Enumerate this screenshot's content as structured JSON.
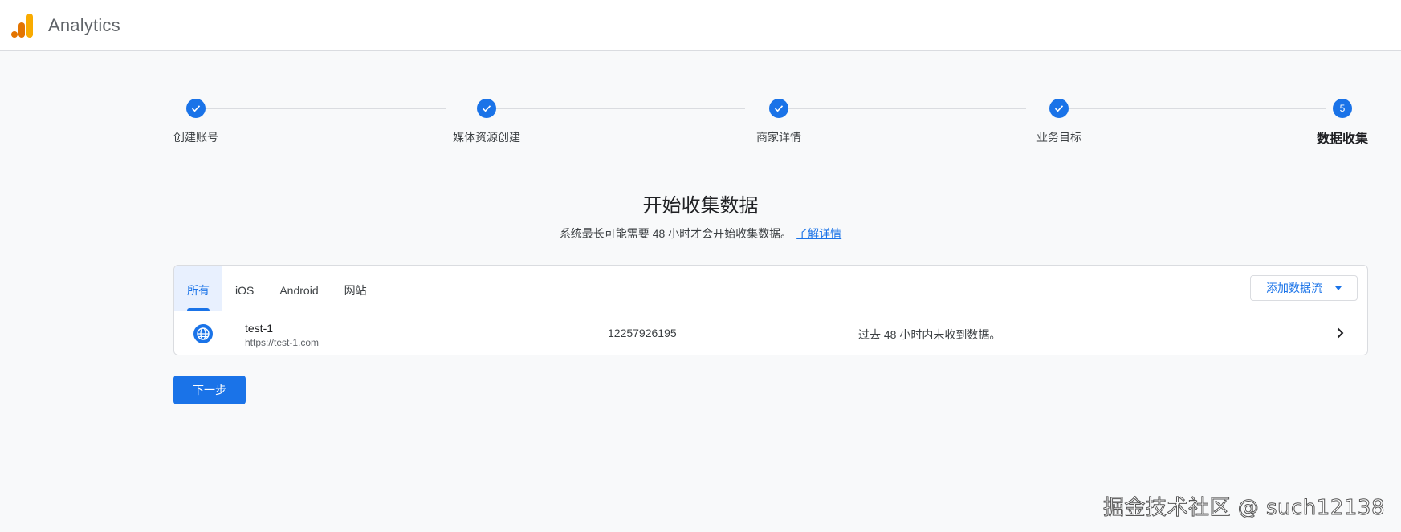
{
  "app": {
    "title": "Analytics"
  },
  "stepper": {
    "steps": [
      {
        "label": "创建账号",
        "state": "done"
      },
      {
        "label": "媒体资源创建",
        "state": "done"
      },
      {
        "label": "商家详情",
        "state": "done"
      },
      {
        "label": "业务目标",
        "state": "done"
      },
      {
        "label": "数据收集",
        "state": "active",
        "number": "5"
      }
    ]
  },
  "main": {
    "heading": "开始收集数据",
    "subheading": "系统最长可能需要 48 小时才会开始收集数据。",
    "learn_more": "了解详情"
  },
  "tabs": [
    {
      "label": "所有",
      "active": true
    },
    {
      "label": "iOS",
      "active": false
    },
    {
      "label": "Android",
      "active": false
    },
    {
      "label": "网站",
      "active": false
    }
  ],
  "add_stream_label": "添加数据流",
  "stream": {
    "name": "test-1",
    "url": "https://test-1.com",
    "id": "12257926195",
    "status": "过去 48 小时内未收到数据。"
  },
  "next_button": "下一步",
  "watermark": "掘金技术社区 @ such12138",
  "colors": {
    "accent": "#1a73e8",
    "logo_orange": "#f9ab00",
    "logo_dark_orange": "#e37400"
  }
}
